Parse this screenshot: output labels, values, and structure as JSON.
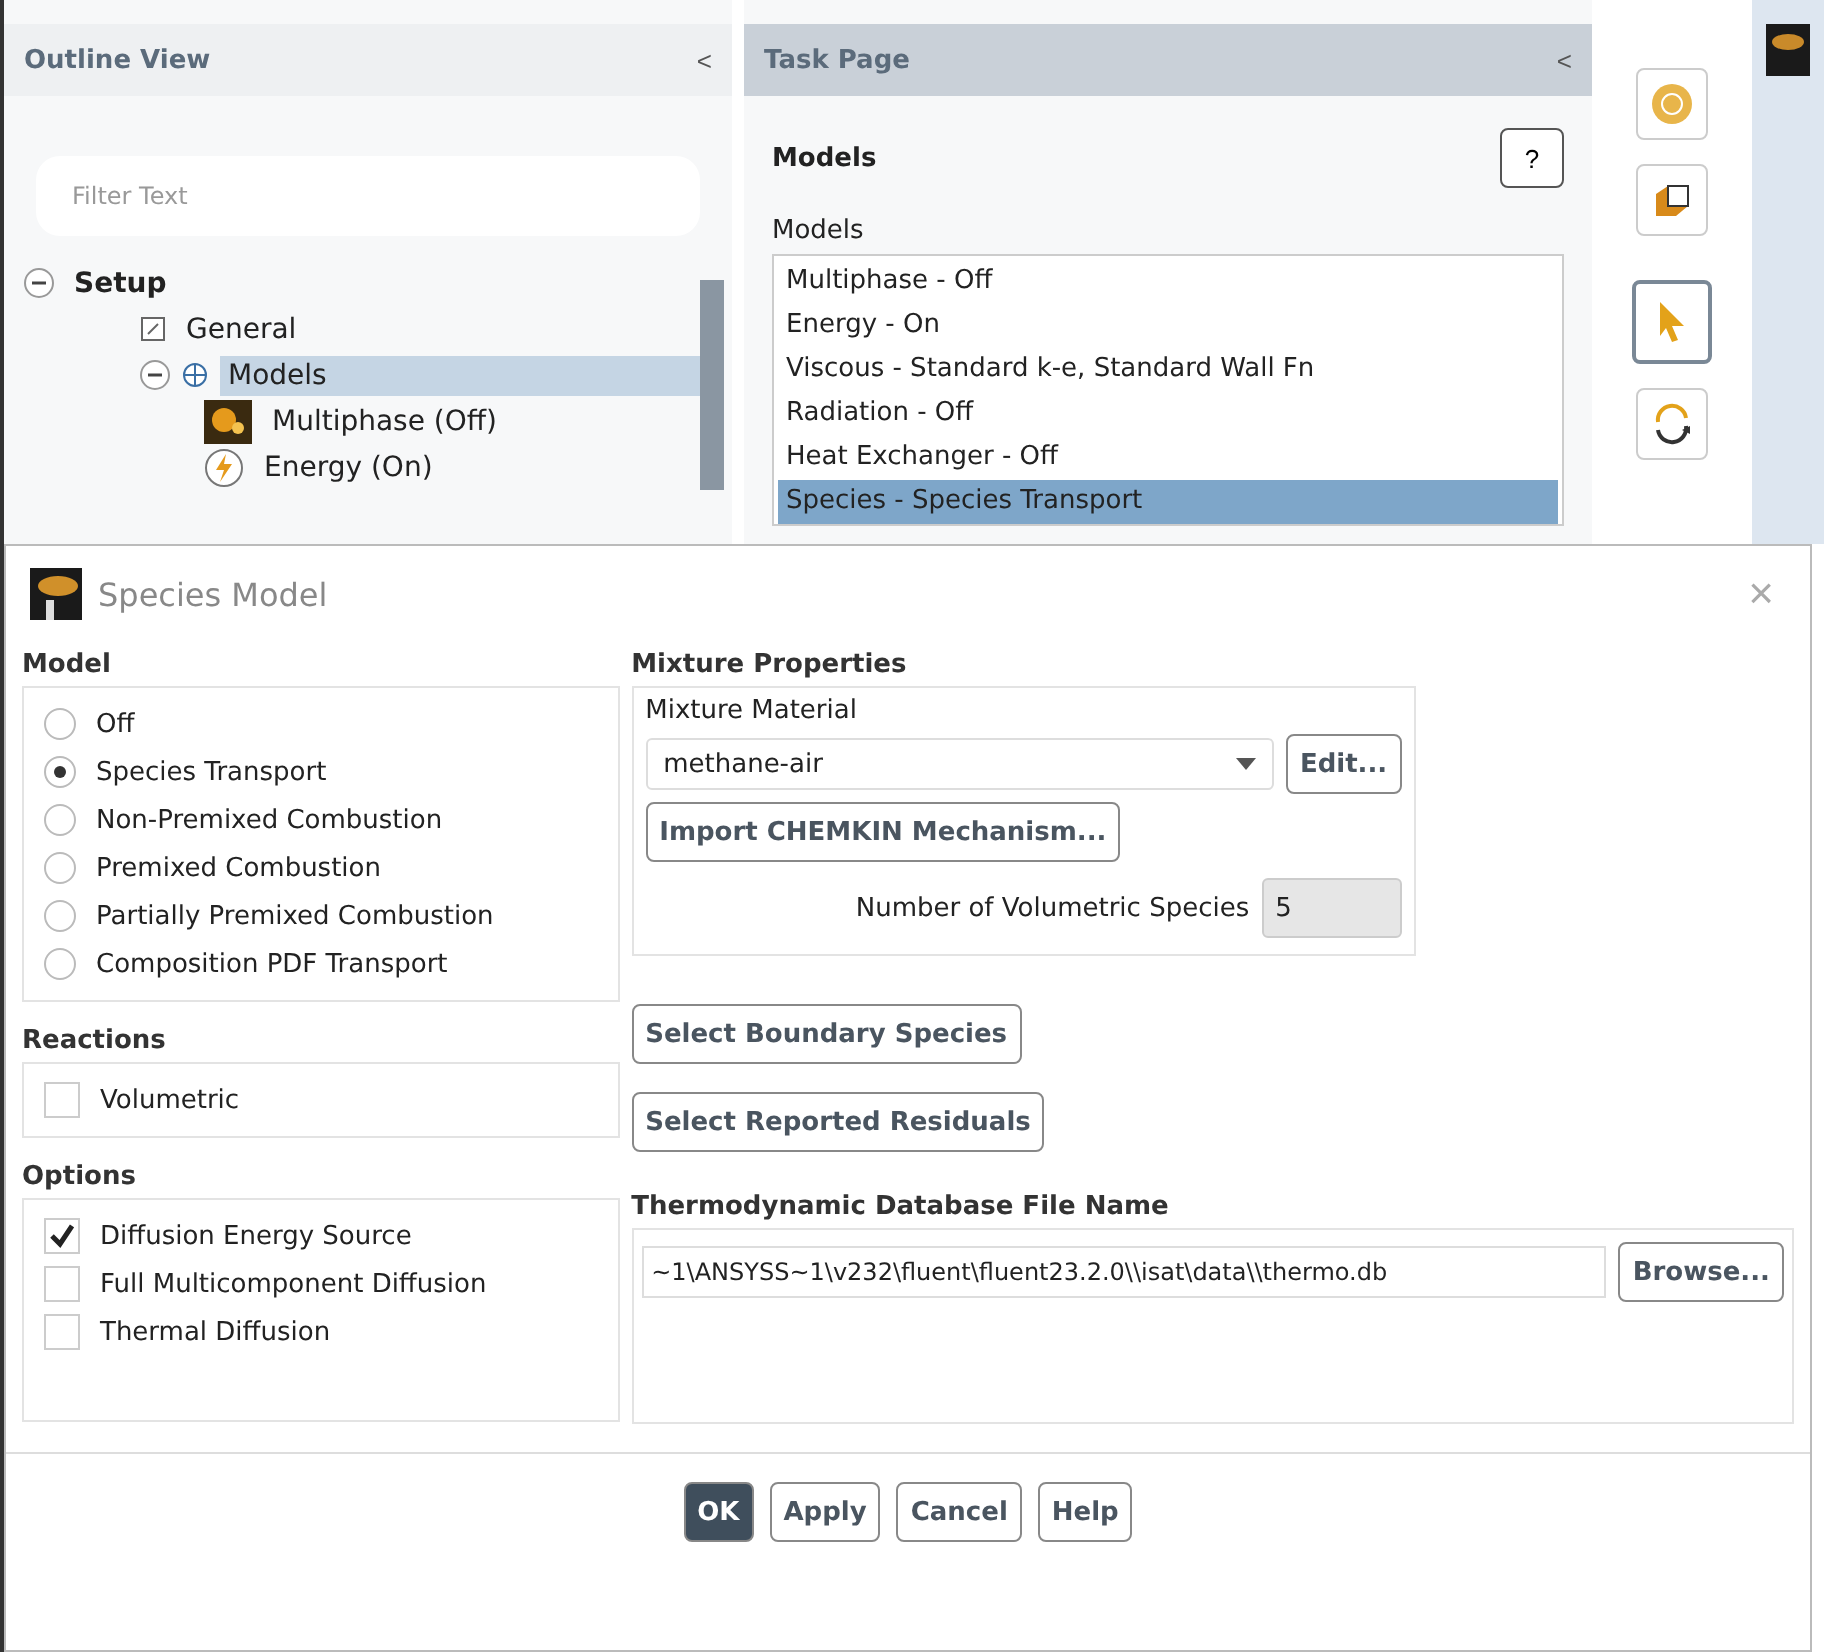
{
  "outline_view": {
    "title": "Outline View",
    "collapse": "<",
    "filter": {
      "placeholder": "Filter Text"
    },
    "tree": [
      {
        "label": "Setup",
        "kind": "root",
        "expanded": true,
        "selected": false,
        "children": [
          {
            "label": "General",
            "kind": "general",
            "selected": false
          },
          {
            "label": "Models",
            "kind": "models",
            "expanded": true,
            "selected": true,
            "children": [
              {
                "label": "Multiphase (Off)",
                "kind": "multiphase",
                "selected": false
              },
              {
                "label": "Energy (On)",
                "kind": "energy",
                "selected": false
              }
            ]
          }
        ]
      }
    ]
  },
  "task_page": {
    "title": "Task Page",
    "collapse": "<",
    "heading": "Models",
    "help": "?",
    "list_label": "Models",
    "models": [
      {
        "label": "Multiphase - Off",
        "selected": false
      },
      {
        "label": "Energy - On",
        "selected": false
      },
      {
        "label": "Viscous - Standard k-e, Standard Wall Fn",
        "selected": false
      },
      {
        "label": "Radiation - Off",
        "selected": false
      },
      {
        "label": "Heat Exchanger - Off",
        "selected": false
      },
      {
        "label": "Species - Species Transport",
        "selected": true
      }
    ]
  },
  "toolbar": [
    {
      "kind": "globe",
      "selected": false
    },
    {
      "kind": "box",
      "selected": false
    },
    {
      "kind": "pointer",
      "selected": true
    },
    {
      "kind": "rotate",
      "selected": false
    }
  ],
  "dialog": {
    "title": "Species Model",
    "close": "×",
    "model": {
      "label": "Model",
      "options": [
        {
          "label": "Off",
          "selected": false
        },
        {
          "label": "Species Transport",
          "selected": true
        },
        {
          "label": "Non-Premixed Combustion",
          "selected": false
        },
        {
          "label": "Premixed Combustion",
          "selected": false
        },
        {
          "label": "Partially Premixed Combustion",
          "selected": false
        },
        {
          "label": "Composition PDF Transport",
          "selected": false
        }
      ]
    },
    "reactions": {
      "label": "Reactions",
      "items": [
        {
          "label": "Volumetric",
          "checked": false
        }
      ]
    },
    "options": {
      "label": "Options",
      "items": [
        {
          "label": "Diffusion Energy Source",
          "checked": true
        },
        {
          "label": "Full Multicomponent Diffusion",
          "checked": false
        },
        {
          "label": "Thermal Diffusion",
          "checked": false
        }
      ]
    },
    "mixture": {
      "label": "Mixture Properties",
      "material_label": "Mixture Material",
      "material": "methane-air",
      "edit": "Edit...",
      "import": "Import CHEMKIN Mechanism...",
      "species_label": "Number of Volumetric Species",
      "species_count": "5"
    },
    "select_buttons": [
      "Select Boundary Species",
      "Select Reported Residuals"
    ],
    "thermo": {
      "label": "Thermodynamic Database File Name",
      "value": "~1\\ANSYSS~1\\v232\\fluent\\fluent23.2.0\\\\isat\\data\\\\thermo.db",
      "browse": "Browse..."
    },
    "buttons": [
      {
        "label": "OK",
        "primary": true
      },
      {
        "label": "Apply",
        "primary": false
      },
      {
        "label": "Cancel",
        "primary": false
      },
      {
        "label": "Help",
        "primary": false
      }
    ]
  }
}
